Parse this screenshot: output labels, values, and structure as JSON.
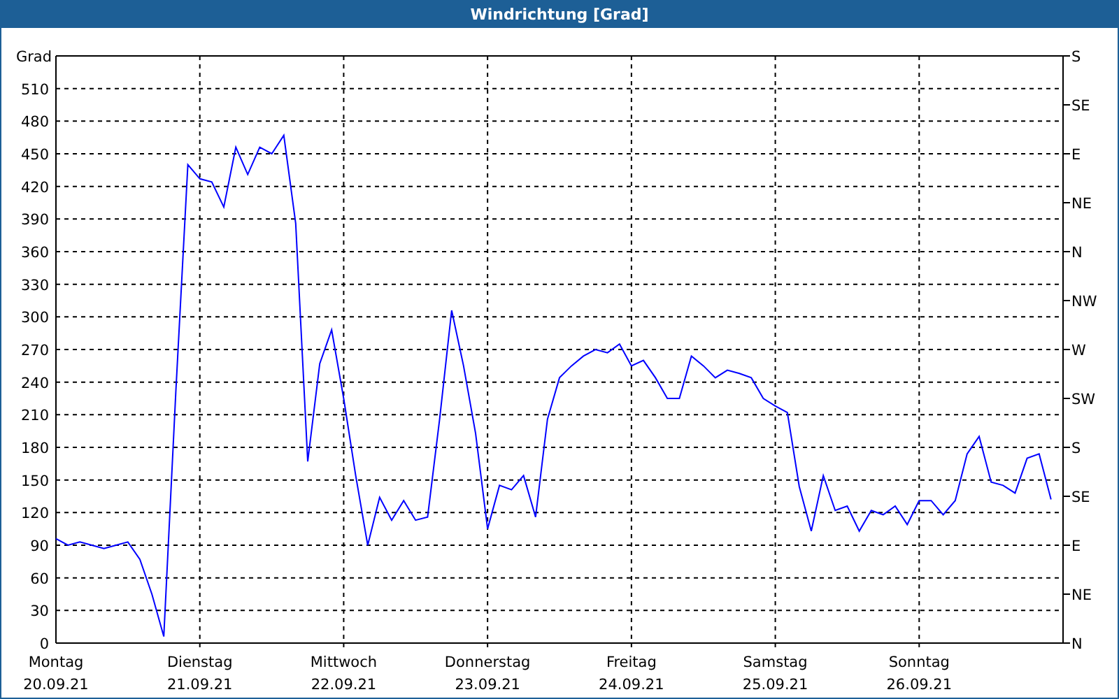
{
  "window": {
    "title": "Windrichtung [Grad]"
  },
  "chart": {
    "chart_data": {
      "type": "line",
      "grid": true,
      "ylabel": "Grad",
      "ylim": [
        0,
        540
      ],
      "yticks": [
        0,
        30,
        60,
        90,
        120,
        150,
        180,
        210,
        240,
        270,
        300,
        330,
        360,
        390,
        420,
        450,
        480,
        510
      ],
      "categories": [
        "Montag",
        null,
        null,
        null,
        null,
        null,
        null,
        null,
        null,
        null,
        null,
        null,
        "Dienstag",
        null,
        null,
        null,
        null,
        null,
        null,
        null,
        null,
        null,
        null,
        null,
        "Mittwoch",
        null,
        null,
        null,
        null,
        null,
        null,
        null,
        null,
        null,
        null,
        null,
        "Donnerstag",
        null,
        null,
        null,
        null,
        null,
        null,
        null,
        null,
        null,
        null,
        null,
        "Freitag",
        null,
        null,
        null,
        null,
        null,
        null,
        null,
        null,
        null,
        null,
        null,
        "Samstag",
        null,
        null,
        null,
        null,
        null,
        null,
        null,
        null,
        null,
        null,
        null,
        "Sonntag",
        null,
        null,
        null,
        null,
        null,
        null,
        null,
        null,
        null,
        null,
        null
      ],
      "series": [
        {
          "color": "#0000ff",
          "values": [
            96,
            90,
            93,
            90,
            87,
            90,
            93,
            77,
            45,
            6,
            231,
            440,
            427,
            424,
            401,
            456,
            431,
            456,
            450,
            467,
            386,
            167,
            257,
            288,
            225,
            154,
            90,
            134,
            113,
            131,
            113,
            116,
            206,
            306,
            255,
            193,
            105,
            145,
            141,
            154,
            116,
            206,
            244,
            255,
            264,
            270,
            267,
            275,
            255,
            260,
            244,
            225,
            225,
            264,
            255,
            244,
            251,
            248,
            244,
            225,
            218,
            212,
            144,
            103,
            154,
            122,
            126,
            103,
            122,
            118,
            126,
            109,
            131,
            131,
            118,
            131,
            174,
            190,
            148,
            145,
            138,
            170,
            174,
            132
          ]
        }
      ]
    },
    "date_labels": [
      "20.09.21",
      "21.09.21",
      "22.09.21",
      "23.09.21",
      "24.09.21",
      "25.09.21",
      "26.09.21"
    ],
    "compass_labels": [
      "S",
      "SE",
      "E",
      "NE",
      "N",
      "NW",
      "W",
      "SW",
      "S",
      "SE",
      "E",
      "NE",
      "N"
    ]
  }
}
